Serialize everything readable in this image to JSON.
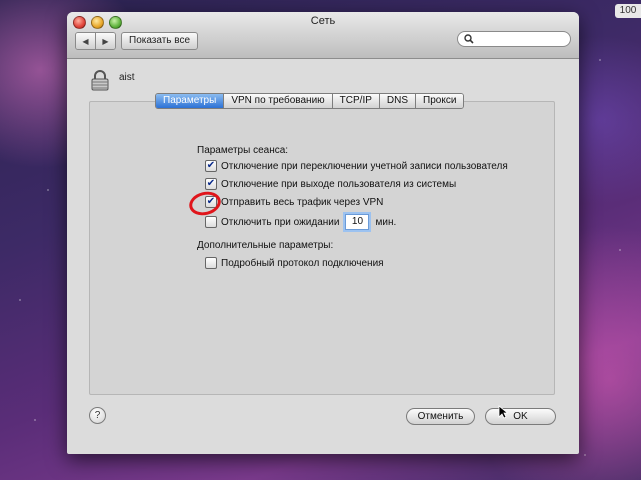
{
  "corner_badge": "100",
  "window": {
    "title": "Сеть",
    "nav": {
      "back_icon": "◀",
      "forward_icon": "▶"
    },
    "show_all_label": "Показать все",
    "search": {
      "icon": "magnifier",
      "value": ""
    }
  },
  "header": {
    "username": "aist"
  },
  "tabs": [
    {
      "label": "Параметры",
      "active": true
    },
    {
      "label": "VPN по требованию",
      "active": false
    },
    {
      "label": "TCP/IP",
      "active": false
    },
    {
      "label": "DNS",
      "active": false
    },
    {
      "label": "Прокси",
      "active": false
    }
  ],
  "session": {
    "heading": "Параметры сеанса:",
    "options": [
      {
        "label": "Отключение при переключении учетной записи пользователя",
        "checked": true
      },
      {
        "label": "Отключение при выходе пользователя из системы",
        "checked": true
      },
      {
        "label": "Отправить весь трафик через VPN",
        "checked": true
      },
      {
        "label": "Отключить при ожидании",
        "checked": false,
        "value": "10",
        "suffix": "мин."
      }
    ]
  },
  "advanced": {
    "heading": "Дополнительные параметры:",
    "options": [
      {
        "label": "Подробный протокол подключения",
        "checked": false
      }
    ]
  },
  "footer": {
    "help_label": "?",
    "cancel_label": "Отменить",
    "ok_label": "OK"
  },
  "colors": {
    "accent": "#2c72d6",
    "highlight": "#e0151b"
  }
}
